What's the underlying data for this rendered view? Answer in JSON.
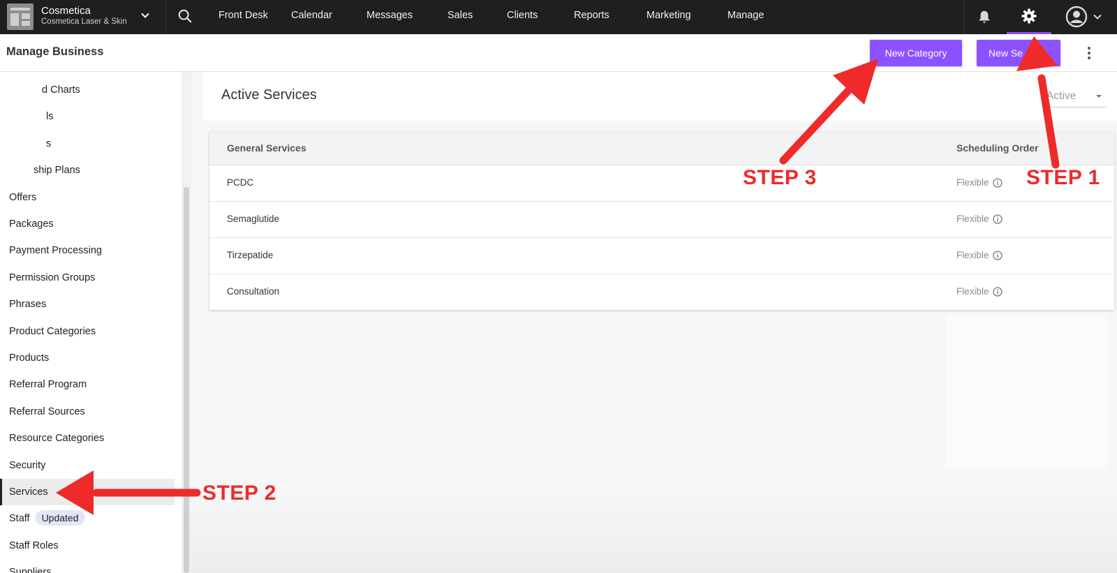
{
  "brand": {
    "name": "Cosmetica",
    "location": "Cosmetica Laser & Skin"
  },
  "nav": {
    "items": [
      "Front Desk",
      "Calendar",
      "Messages",
      "Sales",
      "Clients",
      "Reports",
      "Marketing",
      "Manage"
    ]
  },
  "header": {
    "title": "Manage Business",
    "new_category_label": "New Category",
    "new_service_label": "New Se"
  },
  "sidebar": {
    "items": [
      {
        "label": "d Charts"
      },
      {
        "label": "ls"
      },
      {
        "label": "s"
      },
      {
        "label": "ship Plans"
      },
      {
        "label": "Offers"
      },
      {
        "label": "Packages"
      },
      {
        "label": "Payment Processing"
      },
      {
        "label": "Permission Groups"
      },
      {
        "label": "Phrases"
      },
      {
        "label": "Product Categories"
      },
      {
        "label": "Products"
      },
      {
        "label": "Referral Program"
      },
      {
        "label": "Referral Sources"
      },
      {
        "label": "Resource Categories"
      },
      {
        "label": "Security"
      },
      {
        "label": "Services"
      },
      {
        "label": "Staff",
        "badge": "Updated"
      },
      {
        "label": "Staff Roles"
      },
      {
        "label": "Suppliers"
      }
    ],
    "active_index": 15
  },
  "content": {
    "title": "Active Services",
    "filter_value": "Active"
  },
  "table": {
    "columns": [
      "General Services",
      "Scheduling Order"
    ],
    "rows": [
      {
        "name": "PCDC",
        "order": "Flexible"
      },
      {
        "name": "Semaglutide",
        "order": "Flexible"
      },
      {
        "name": "Tirzepatide",
        "order": "Flexible"
      },
      {
        "name": "Consultation",
        "order": "Flexible"
      }
    ]
  },
  "annotations": {
    "step1": "STEP 1",
    "step2": "STEP 2",
    "step3": "STEP 3"
  },
  "colors": {
    "accent": "#8c52ff",
    "topbar": "#1f1f1f",
    "annotation": "#ee2a2a"
  }
}
